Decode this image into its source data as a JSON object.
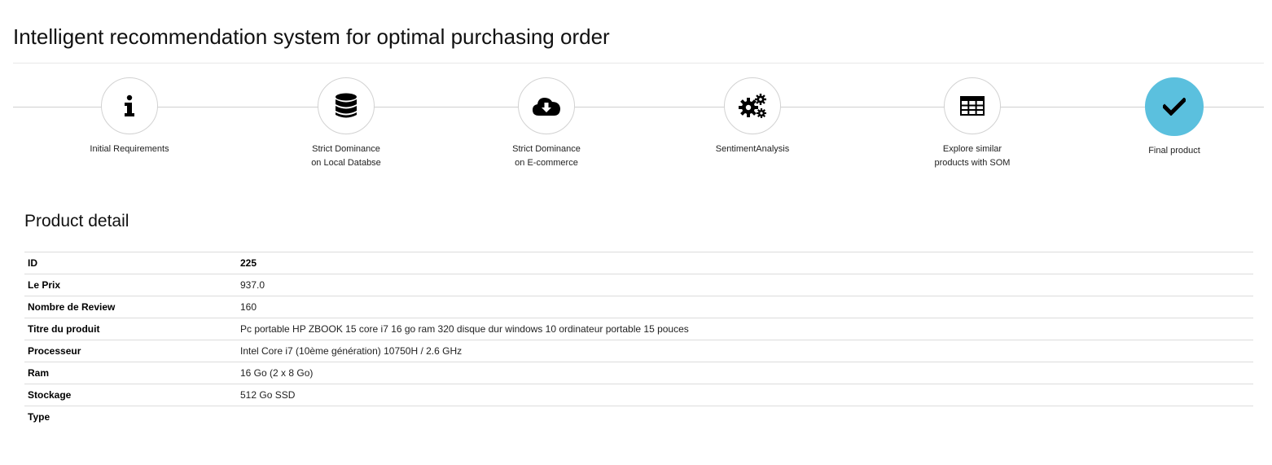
{
  "header": {
    "title": "Intelligent recommendation system for optimal purchasing order"
  },
  "steps": [
    {
      "label": "Initial Requirements",
      "icon": "info-icon"
    },
    {
      "label": "Strict Dominance\non Local Databse",
      "icon": "database-icon"
    },
    {
      "label": "Strict Dominance\non E-commerce",
      "icon": "cloud-download-icon"
    },
    {
      "label": "SentimentAnalysis",
      "icon": "gears-icon"
    },
    {
      "label": "Explore similar\nproducts with SOM",
      "icon": "table-icon"
    },
    {
      "label": "Final product",
      "icon": "check-icon",
      "active": true
    }
  ],
  "colors": {
    "active_step": "#5bc0de"
  },
  "detail": {
    "title": "Product detail",
    "rows": [
      {
        "key": "ID",
        "value": "225"
      },
      {
        "key": "Le Prix",
        "value": "937.0"
      },
      {
        "key": "Nombre de Review",
        "value": "160"
      },
      {
        "key": "Titre du produit",
        "value": "Pc portable HP ZBOOK 15 core i7 16 go ram 320 disque dur windows 10 ordinateur portable 15 pouces"
      },
      {
        "key": "Processeur",
        "value": "Intel Core i7 (10ème génération) 10750H / 2.6 GHz"
      },
      {
        "key": "Ram",
        "value": "16 Go (2 x 8 Go)"
      },
      {
        "key": "Stockage",
        "value": "512 Go SSD"
      },
      {
        "key": "Type",
        "value": ""
      }
    ]
  }
}
